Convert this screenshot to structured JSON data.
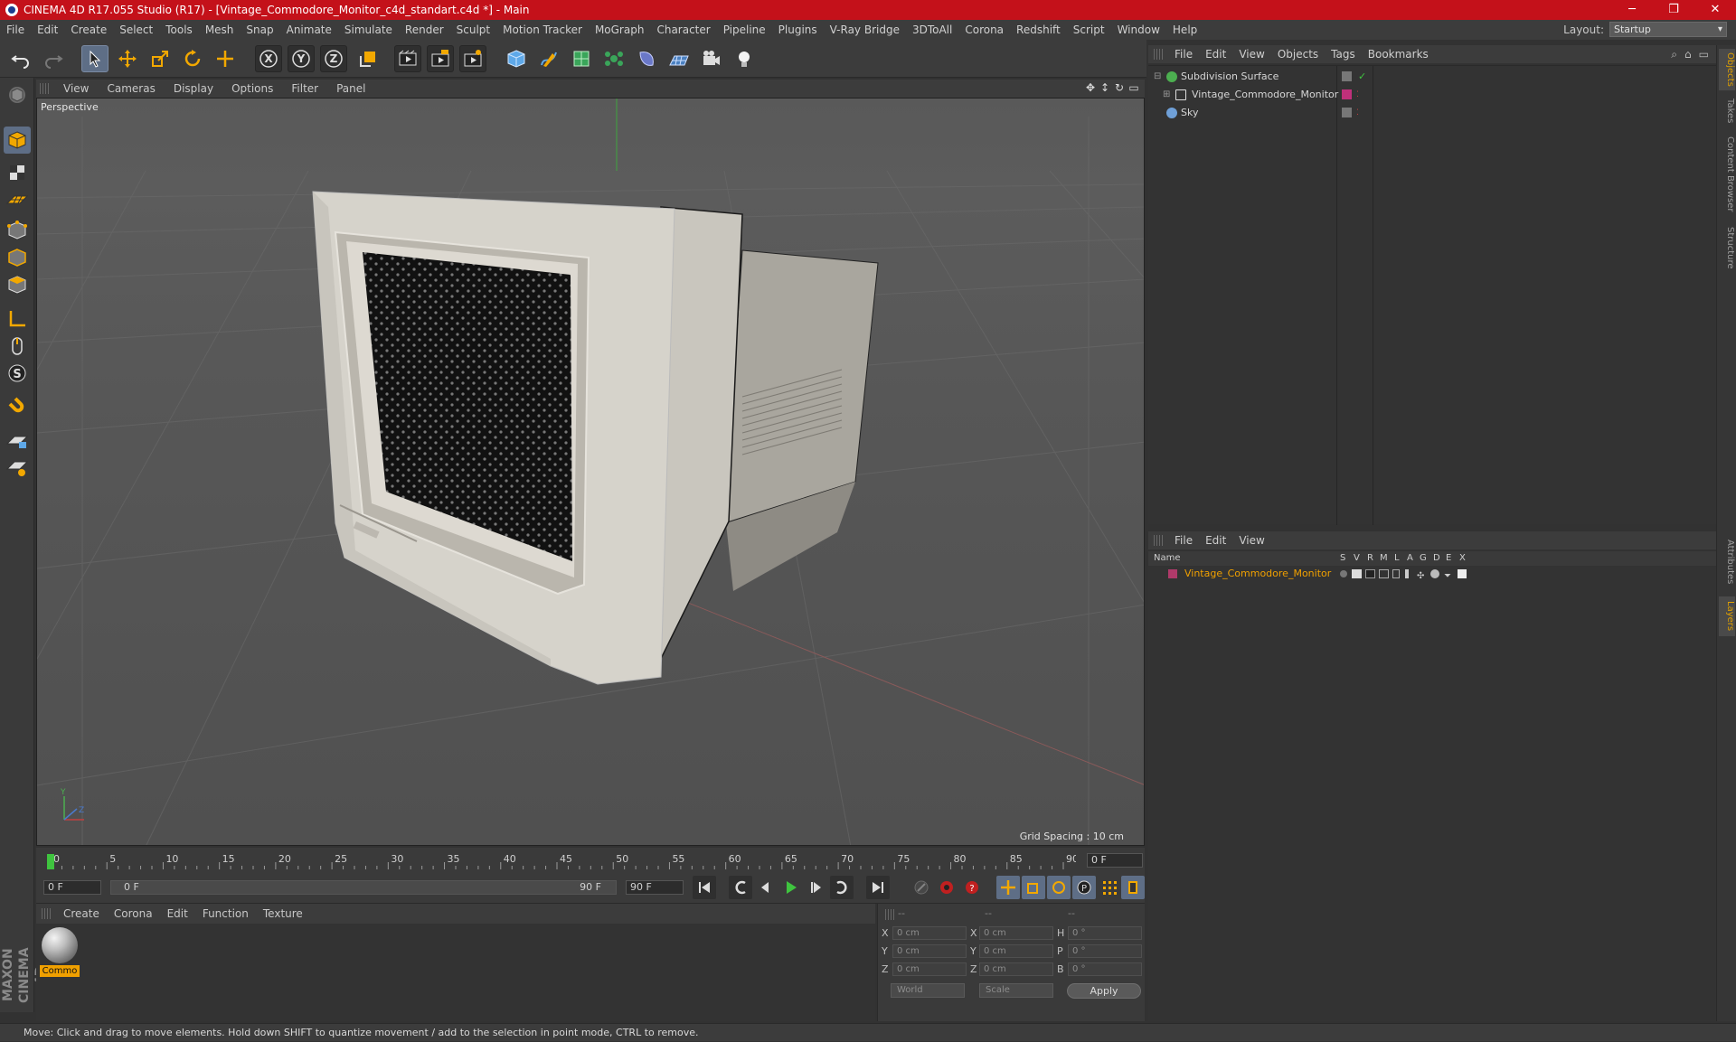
{
  "window": {
    "title": "CINEMA 4D R17.055 Studio (R17) - [Vintage_Commodore_Monitor_c4d_standart.c4d *] - Main",
    "minimize": "─",
    "maximize": "❐",
    "close": "✕"
  },
  "menubar": {
    "items": [
      "File",
      "Edit",
      "Create",
      "Select",
      "Tools",
      "Mesh",
      "Snap",
      "Animate",
      "Simulate",
      "Render",
      "Sculpt",
      "Motion Tracker",
      "MoGraph",
      "Character",
      "Pipeline",
      "Plugins",
      "V-Ray Bridge",
      "3DToAll",
      "Corona",
      "Redshift",
      "Script",
      "Window",
      "Help"
    ],
    "layout_label": "Layout:",
    "layout_value": "Startup"
  },
  "toolbar": {
    "icons": [
      "undo-icon",
      "redo-icon",
      "live-selection-icon",
      "move-icon",
      "scale-icon",
      "rotate-icon",
      "last-tool-icon",
      "x-axis-icon",
      "y-axis-icon",
      "z-axis-icon",
      "coordinate-system-icon",
      "render-view-icon",
      "render-picture-viewer-icon",
      "edit-render-settings-icon",
      "cube-icon",
      "pen-spline-icon",
      "subdivision-surface-icon",
      "cloner-icon",
      "deformer-icon",
      "floor-icon",
      "camera-icon",
      "light-icon"
    ],
    "axis_x": "X",
    "axis_y": "Y",
    "axis_z": "Z"
  },
  "viewport": {
    "menu": [
      "View",
      "Cameras",
      "Display",
      "Options",
      "Filter",
      "Panel"
    ],
    "label": "Perspective",
    "grid_spacing": "Grid Spacing : 10 cm"
  },
  "timeline": {
    "ticks": [
      "0",
      "5",
      "10",
      "15",
      "20",
      "25",
      "30",
      "35",
      "40",
      "45",
      "50",
      "55",
      "60",
      "65",
      "70",
      "75",
      "80",
      "85",
      "90"
    ],
    "current_frame": "0 F",
    "start_field": "0 F",
    "range_start": "0 F",
    "range_end": "90 F",
    "end_field": "90 F"
  },
  "material_manager": {
    "menu": [
      "Create",
      "Corona",
      "Edit",
      "Function",
      "Texture"
    ],
    "materials": [
      {
        "name": "Commo"
      }
    ]
  },
  "coordinates": {
    "header": [
      "--",
      "--",
      "--"
    ],
    "rows": [
      {
        "l1": "X",
        "v1": "0 cm",
        "l2": "X",
        "v2": "0 cm",
        "l3": "H",
        "v3": "0 °"
      },
      {
        "l1": "Y",
        "v1": "0 cm",
        "l2": "Y",
        "v2": "0 cm",
        "l3": "P",
        "v3": "0 °"
      },
      {
        "l1": "Z",
        "v1": "0 cm",
        "l2": "Z",
        "v2": "0 cm",
        "l3": "B",
        "v3": "0 °"
      }
    ],
    "mode1": "World",
    "mode2": "Scale",
    "apply": "Apply"
  },
  "object_manager": {
    "menu": [
      "File",
      "Edit",
      "View",
      "Objects",
      "Tags",
      "Bookmarks"
    ],
    "objects": [
      {
        "name": "Subdivision Surface",
        "icon_color": "#4caf50"
      },
      {
        "name": "Vintage_Commodore_Monitor",
        "icon_color": "#d0d0d0"
      },
      {
        "name": "Sky",
        "icon_color": "#6fa0d8"
      }
    ]
  },
  "layer_manager": {
    "menu": [
      "File",
      "Edit",
      "View"
    ],
    "columns": [
      "Name",
      "S",
      "V",
      "R",
      "M",
      "L",
      "A",
      "G",
      "D",
      "E",
      "X"
    ],
    "layers": [
      {
        "name": "Vintage_Commodore_Monitor",
        "color": "#b03a6a"
      }
    ]
  },
  "right_tabs": [
    "Objects",
    "Takes",
    "Content Browser",
    "Structure",
    "Attributes",
    "Layers"
  ],
  "status": "Move: Click and drag to move elements. Hold down SHIFT to quantize movement / add to the selection in point mode, CTRL to remove.",
  "brand": "MAXON CINEMA 4D",
  "colors": {
    "accent": "#c4111a",
    "selection": "#5e6e86",
    "highlight_text": "#f0a000"
  }
}
